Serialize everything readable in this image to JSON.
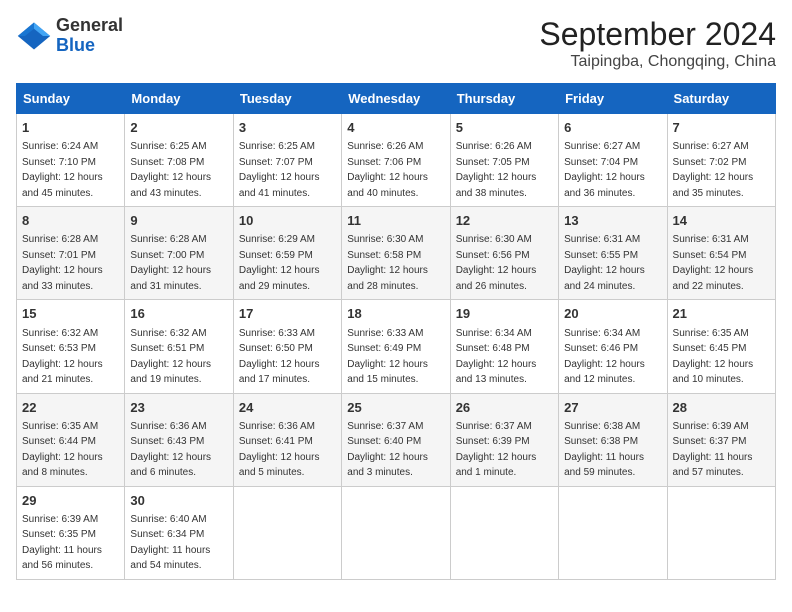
{
  "logo": {
    "general": "General",
    "blue": "Blue"
  },
  "header": {
    "month": "September 2024",
    "location": "Taipingba, Chongqing, China"
  },
  "weekdays": [
    "Sunday",
    "Monday",
    "Tuesday",
    "Wednesday",
    "Thursday",
    "Friday",
    "Saturday"
  ],
  "weeks": [
    [
      {
        "day": "1",
        "sunrise": "6:24 AM",
        "sunset": "7:10 PM",
        "daylight": "12 hours and 45 minutes."
      },
      {
        "day": "2",
        "sunrise": "6:25 AM",
        "sunset": "7:08 PM",
        "daylight": "12 hours and 43 minutes."
      },
      {
        "day": "3",
        "sunrise": "6:25 AM",
        "sunset": "7:07 PM",
        "daylight": "12 hours and 41 minutes."
      },
      {
        "day": "4",
        "sunrise": "6:26 AM",
        "sunset": "7:06 PM",
        "daylight": "12 hours and 40 minutes."
      },
      {
        "day": "5",
        "sunrise": "6:26 AM",
        "sunset": "7:05 PM",
        "daylight": "12 hours and 38 minutes."
      },
      {
        "day": "6",
        "sunrise": "6:27 AM",
        "sunset": "7:04 PM",
        "daylight": "12 hours and 36 minutes."
      },
      {
        "day": "7",
        "sunrise": "6:27 AM",
        "sunset": "7:02 PM",
        "daylight": "12 hours and 35 minutes."
      }
    ],
    [
      {
        "day": "8",
        "sunrise": "6:28 AM",
        "sunset": "7:01 PM",
        "daylight": "12 hours and 33 minutes."
      },
      {
        "day": "9",
        "sunrise": "6:28 AM",
        "sunset": "7:00 PM",
        "daylight": "12 hours and 31 minutes."
      },
      {
        "day": "10",
        "sunrise": "6:29 AM",
        "sunset": "6:59 PM",
        "daylight": "12 hours and 29 minutes."
      },
      {
        "day": "11",
        "sunrise": "6:30 AM",
        "sunset": "6:58 PM",
        "daylight": "12 hours and 28 minutes."
      },
      {
        "day": "12",
        "sunrise": "6:30 AM",
        "sunset": "6:56 PM",
        "daylight": "12 hours and 26 minutes."
      },
      {
        "day": "13",
        "sunrise": "6:31 AM",
        "sunset": "6:55 PM",
        "daylight": "12 hours and 24 minutes."
      },
      {
        "day": "14",
        "sunrise": "6:31 AM",
        "sunset": "6:54 PM",
        "daylight": "12 hours and 22 minutes."
      }
    ],
    [
      {
        "day": "15",
        "sunrise": "6:32 AM",
        "sunset": "6:53 PM",
        "daylight": "12 hours and 21 minutes."
      },
      {
        "day": "16",
        "sunrise": "6:32 AM",
        "sunset": "6:51 PM",
        "daylight": "12 hours and 19 minutes."
      },
      {
        "day": "17",
        "sunrise": "6:33 AM",
        "sunset": "6:50 PM",
        "daylight": "12 hours and 17 minutes."
      },
      {
        "day": "18",
        "sunrise": "6:33 AM",
        "sunset": "6:49 PM",
        "daylight": "12 hours and 15 minutes."
      },
      {
        "day": "19",
        "sunrise": "6:34 AM",
        "sunset": "6:48 PM",
        "daylight": "12 hours and 13 minutes."
      },
      {
        "day": "20",
        "sunrise": "6:34 AM",
        "sunset": "6:46 PM",
        "daylight": "12 hours and 12 minutes."
      },
      {
        "day": "21",
        "sunrise": "6:35 AM",
        "sunset": "6:45 PM",
        "daylight": "12 hours and 10 minutes."
      }
    ],
    [
      {
        "day": "22",
        "sunrise": "6:35 AM",
        "sunset": "6:44 PM",
        "daylight": "12 hours and 8 minutes."
      },
      {
        "day": "23",
        "sunrise": "6:36 AM",
        "sunset": "6:43 PM",
        "daylight": "12 hours and 6 minutes."
      },
      {
        "day": "24",
        "sunrise": "6:36 AM",
        "sunset": "6:41 PM",
        "daylight": "12 hours and 5 minutes."
      },
      {
        "day": "25",
        "sunrise": "6:37 AM",
        "sunset": "6:40 PM",
        "daylight": "12 hours and 3 minutes."
      },
      {
        "day": "26",
        "sunrise": "6:37 AM",
        "sunset": "6:39 PM",
        "daylight": "12 hours and 1 minute."
      },
      {
        "day": "27",
        "sunrise": "6:38 AM",
        "sunset": "6:38 PM",
        "daylight": "11 hours and 59 minutes."
      },
      {
        "day": "28",
        "sunrise": "6:39 AM",
        "sunset": "6:37 PM",
        "daylight": "11 hours and 57 minutes."
      }
    ],
    [
      {
        "day": "29",
        "sunrise": "6:39 AM",
        "sunset": "6:35 PM",
        "daylight": "11 hours and 56 minutes."
      },
      {
        "day": "30",
        "sunrise": "6:40 AM",
        "sunset": "6:34 PM",
        "daylight": "11 hours and 54 minutes."
      },
      null,
      null,
      null,
      null,
      null
    ]
  ],
  "labels": {
    "sunrise": "Sunrise: ",
    "sunset": "Sunset: ",
    "daylight": "Daylight: "
  }
}
